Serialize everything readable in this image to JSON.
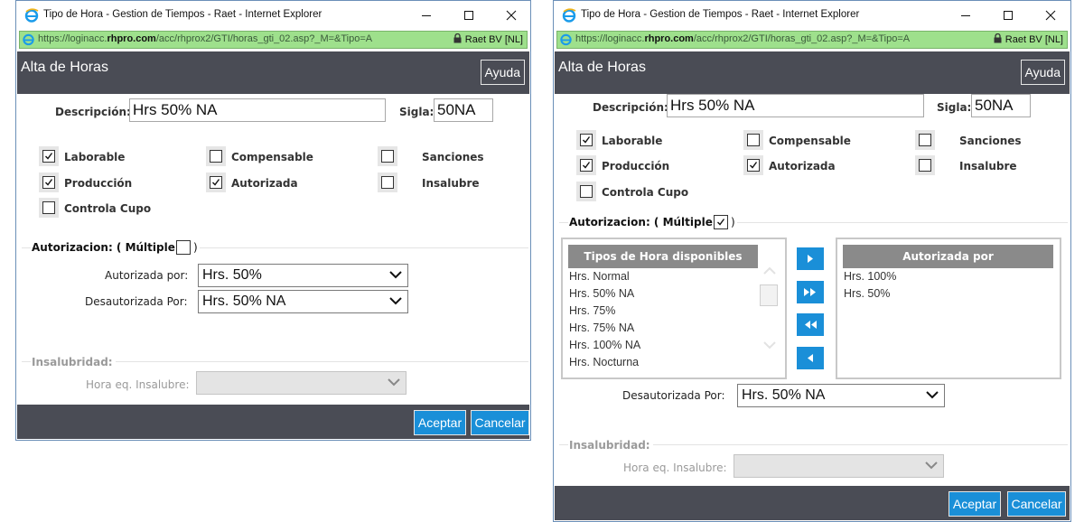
{
  "window": {
    "title": "Tipo de Hora - Gestion de Tiempos - Raet - Internet Explorer",
    "url_prefix": "https://loginacc.",
    "url_domain": "rhpro.com",
    "url_suffix": "/acc/rhprox2/GTI/horas_gti_02.asp?_M=&Tipo=A",
    "cert": "Raet BV [NL]"
  },
  "header": {
    "title": "Alta de Horas",
    "help_button": "Ayuda"
  },
  "form": {
    "descripcion_label": "Descripción:",
    "descripcion_value": "Hrs 50% NA",
    "sigla_label": "Sigla:",
    "sigla_value": "50NA",
    "checkboxes": {
      "laborable": "Laborable",
      "compensable": "Compensable",
      "sanciones": "Sanciones",
      "produccion": "Producción",
      "autorizada": "Autorizada",
      "insalubre": "Insalubre",
      "controla_cupo": "Controla Cupo"
    },
    "autorizacion_label": "Autorizacion: ( Múltiple",
    "autorizacion_close": ")",
    "autorizada_por_label": "Autorizada por:",
    "autorizada_por_value": "Hrs. 50%",
    "desautorizada_por_label": "Desautorizada Por:",
    "desautorizada_por_value": "Hrs. 50% NA",
    "insalubridad_label": "Insalubridad:",
    "hora_eq_label": "Hora eq. Insalubre:",
    "hora_eq_value": ""
  },
  "left_state": {
    "laborable": true,
    "compensable": false,
    "sanciones": false,
    "produccion": true,
    "autorizada": true,
    "insalubre": false,
    "controla_cupo": false,
    "multiple": false
  },
  "right_state": {
    "laborable": true,
    "compensable": false,
    "sanciones": false,
    "produccion": true,
    "autorizada": true,
    "insalubre": false,
    "controla_cupo": false,
    "multiple": true
  },
  "dual_list": {
    "available_header": "Tipos de Hora disponibles",
    "available": [
      "Hrs. Normal",
      "Hrs. 50% NA",
      "Hrs. 75%",
      "Hrs. 75% NA",
      "Hrs. 100% NA",
      "Hrs. Nocturna"
    ],
    "selected_header": "Autorizada por",
    "selected": [
      "Hrs. 100%",
      "Hrs. 50%"
    ]
  },
  "footer": {
    "accept": "Aceptar",
    "cancel": "Cancelar"
  },
  "colors": {
    "header_bg": "#4a4c55",
    "button_blue": "#1a8fd8",
    "addr_green": "#9ee08c"
  }
}
